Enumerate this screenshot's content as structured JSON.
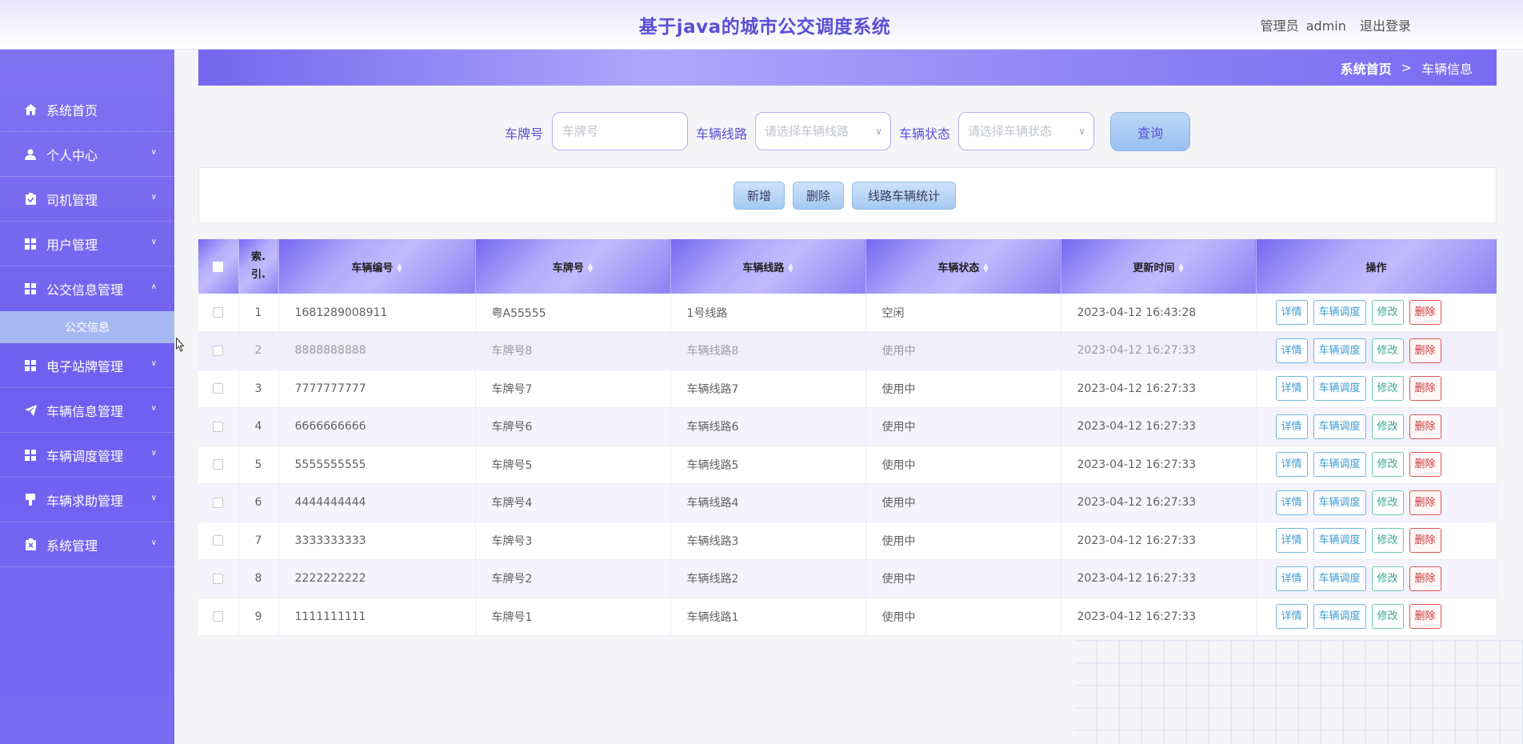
{
  "header": {
    "title": "基于java的城市公交调度系统",
    "role": "管理员",
    "username": "admin",
    "logout": "退出登录"
  },
  "sidebar": {
    "items": [
      {
        "label": "系统首页",
        "icon": "home-icon"
      },
      {
        "label": "个人中心",
        "icon": "user-icon"
      },
      {
        "label": "司机管理",
        "icon": "clipboard-icon"
      },
      {
        "label": "用户管理",
        "icon": "grid-icon"
      },
      {
        "label": "公交信息管理",
        "icon": "grid-icon",
        "expanded": true
      },
      {
        "label": "电子站牌管理",
        "icon": "grid-icon"
      },
      {
        "label": "车辆信息管理",
        "icon": "send-icon"
      },
      {
        "label": "车辆调度管理",
        "icon": "grid-icon"
      },
      {
        "label": "车辆求助管理",
        "icon": "stamp-icon"
      },
      {
        "label": "系统管理",
        "icon": "clipboard-x-icon"
      }
    ],
    "subitem": "公交信息"
  },
  "breadcrumb": {
    "home": "系统首页",
    "separator": ">",
    "current": "车辆信息"
  },
  "search": {
    "plate_label": "车牌号",
    "plate_placeholder": "车牌号",
    "route_label": "车辆线路",
    "route_placeholder": "请选择车辆线路",
    "status_label": "车辆状态",
    "status_placeholder": "请选择车辆状态",
    "query": "查询"
  },
  "actions": {
    "add": "新增",
    "delete": "删除",
    "stats": "线路车辆统计"
  },
  "table": {
    "columns": {
      "index_line1": "索.",
      "index_line2": "引.",
      "vehicle_no": "车辆编号",
      "plate": "车牌号",
      "route": "车辆线路",
      "status": "车辆状态",
      "updated": "更新时间",
      "ops": "操作"
    },
    "op_labels": {
      "detail": "详情",
      "dispatch": "车辆调度",
      "edit": "修改",
      "delete": "删除"
    },
    "rows": [
      {
        "idx": "1",
        "vehicle_no": "1681289008911",
        "plate": "粤A55555",
        "route": "1号线路",
        "status": "空闲",
        "updated": "2023-04-12 16:43:28"
      },
      {
        "idx": "2",
        "vehicle_no": "8888888888",
        "plate": "车牌号8",
        "route": "车辆线路8",
        "status": "使用中",
        "updated": "2023-04-12 16:27:33"
      },
      {
        "idx": "3",
        "vehicle_no": "7777777777",
        "plate": "车牌号7",
        "route": "车辆线路7",
        "status": "使用中",
        "updated": "2023-04-12 16:27:33"
      },
      {
        "idx": "4",
        "vehicle_no": "6666666666",
        "plate": "车牌号6",
        "route": "车辆线路6",
        "status": "使用中",
        "updated": "2023-04-12 16:27:33"
      },
      {
        "idx": "5",
        "vehicle_no": "5555555555",
        "plate": "车牌号5",
        "route": "车辆线路5",
        "status": "使用中",
        "updated": "2023-04-12 16:27:33"
      },
      {
        "idx": "6",
        "vehicle_no": "4444444444",
        "plate": "车牌号4",
        "route": "车辆线路4",
        "status": "使用中",
        "updated": "2023-04-12 16:27:33"
      },
      {
        "idx": "7",
        "vehicle_no": "3333333333",
        "plate": "车牌号3",
        "route": "车辆线路3",
        "status": "使用中",
        "updated": "2023-04-12 16:27:33"
      },
      {
        "idx": "8",
        "vehicle_no": "2222222222",
        "plate": "车牌号2",
        "route": "车辆线路2",
        "status": "使用中",
        "updated": "2023-04-12 16:27:33"
      },
      {
        "idx": "9",
        "vehicle_no": "1111111111",
        "plate": "车牌号1",
        "route": "车辆线路1",
        "status": "使用中",
        "updated": "2023-04-12 16:27:33"
      }
    ]
  },
  "colors": {
    "accent": "#6e5ff0",
    "title": "#5a4fd6"
  }
}
